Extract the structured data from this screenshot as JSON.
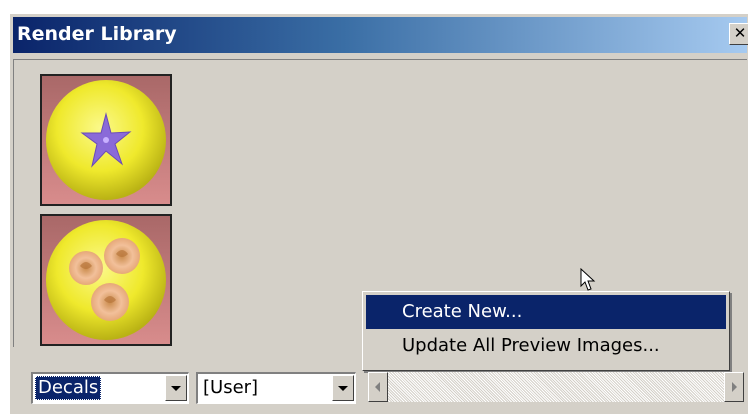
{
  "window": {
    "title": "Render Library",
    "close_icon": "close-icon",
    "close_glyph": "✕"
  },
  "library": {
    "items": [
      {
        "icon": "decal-star-flower-thumbnail"
      },
      {
        "icon": "decal-roses-thumbnail"
      }
    ]
  },
  "context_menu": {
    "items": [
      {
        "label": "Create New...",
        "selected": true
      },
      {
        "label": "Update All Preview Images...",
        "selected": false
      }
    ]
  },
  "footer": {
    "category_select": {
      "value": "Decals",
      "icon": "dropdown-arrow-icon"
    },
    "scope_select": {
      "value": "[User]",
      "icon": "dropdown-arrow-icon"
    }
  },
  "colors": {
    "titlebar_start": "#0a246a",
    "titlebar_end": "#a6caf0",
    "selection": "#0a246a",
    "panel": "#d4d0c8",
    "thumb_bg": "#b87a7a",
    "sphere": "#f0ec2a"
  }
}
